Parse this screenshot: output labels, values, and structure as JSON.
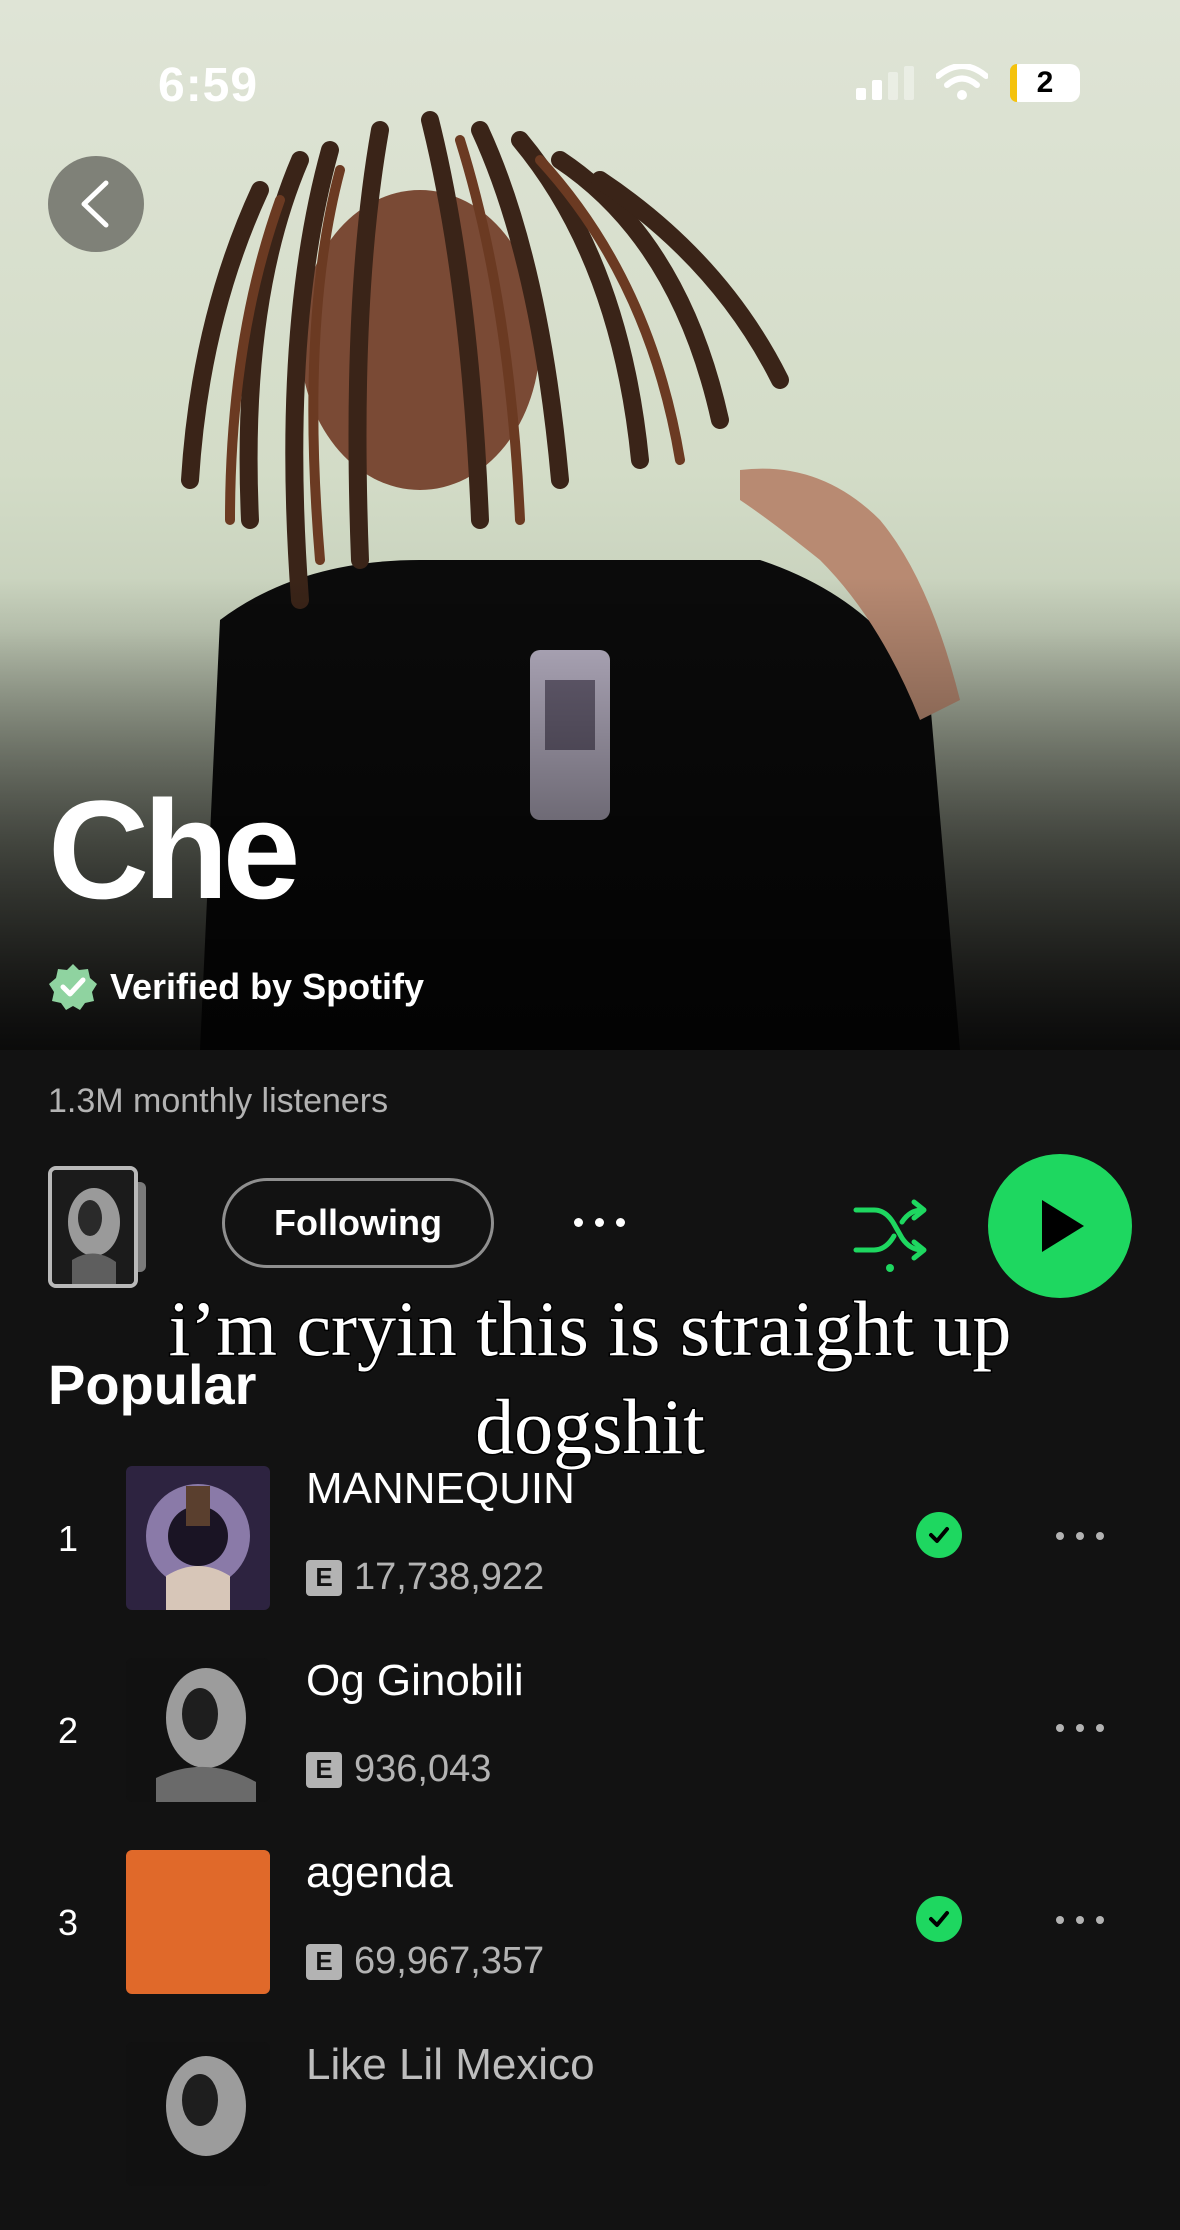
{
  "status_bar": {
    "time": "6:59",
    "battery": "2"
  },
  "artist": {
    "name": "Che",
    "verified_label": "Verified by Spotify",
    "monthly_listeners": "1.3M monthly listeners"
  },
  "controls": {
    "follow_label": "Following"
  },
  "caption": {
    "line1": "i’m cryin this is straight up",
    "line2": "dogshit"
  },
  "popular": {
    "title": "Popular",
    "tracks": [
      {
        "rank": "1",
        "title": "MANNEQUIN",
        "explicit": "E",
        "plays": "17,738,922",
        "saved": true,
        "cover_color": "#5b4a6e"
      },
      {
        "rank": "2",
        "title": "Og Ginobili",
        "explicit": "E",
        "plays": "936,043",
        "saved": false,
        "cover_color": "#1a1a1a"
      },
      {
        "rank": "3",
        "title": "agenda",
        "explicit": "E",
        "plays": "69,967,357",
        "saved": true,
        "cover_color": "#e0692a"
      },
      {
        "rank": "",
        "title": "Like Lil Mexico",
        "explicit": "",
        "plays": "",
        "saved": false,
        "cover_color": "#1a1a1a"
      }
    ]
  },
  "colors": {
    "accent": "#1ed760",
    "background": "#121212",
    "muted_text": "#b3b3b3"
  }
}
